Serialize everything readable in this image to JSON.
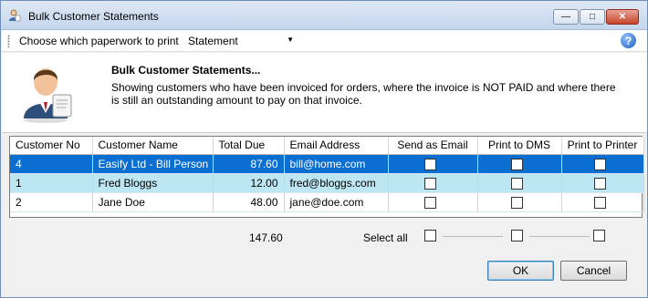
{
  "window": {
    "title": "Bulk Customer Statements",
    "buttons": {
      "minimize": "—",
      "maximize": "□",
      "close": "✕"
    }
  },
  "toolbar": {
    "label": "Choose which paperwork to print",
    "selected_option": "Statement",
    "help": "?"
  },
  "header": {
    "title": "Bulk Customer Statements...",
    "description": "Showing customers who have been invoiced for orders, where the invoice is NOT PAID and where there is still an outstanding amount to pay on that invoice."
  },
  "table": {
    "columns": {
      "customer_no": "Customer No",
      "customer_name": "Customer Name",
      "total_due": "Total Due",
      "email": "Email Address",
      "send_email": "Send as Email",
      "print_dms": "Print to DMS",
      "print_printer": "Print to Printer"
    },
    "rows": [
      {
        "customer_no": "4",
        "customer_name": "Easify Ltd - Bill Person",
        "total_due": "87.60",
        "email": "bill@home.com"
      },
      {
        "customer_no": "1",
        "customer_name": "Fred Bloggs",
        "total_due": "12.00",
        "email": "fred@bloggs.com"
      },
      {
        "customer_no": "2",
        "customer_name": "Jane Doe",
        "total_due": "48.00",
        "email": "jane@doe.com"
      }
    ]
  },
  "footer": {
    "total": "147.60",
    "select_all_label": "Select all"
  },
  "buttons": {
    "ok": "OK",
    "cancel": "Cancel"
  },
  "colors": {
    "selected_row": "#0a6fd1",
    "alt_row": "#bde6f3",
    "title_bar": "#c4d5ec"
  }
}
